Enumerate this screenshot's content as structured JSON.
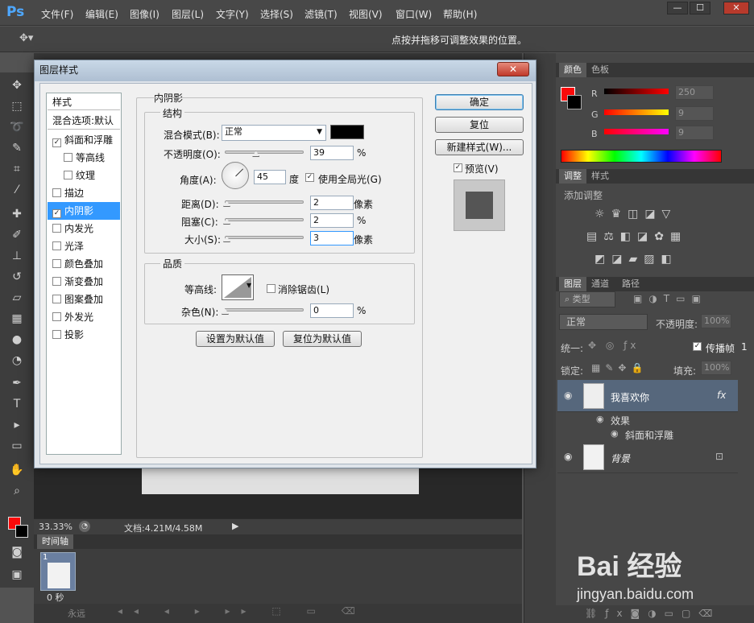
{
  "app": {
    "logo": "Ps"
  },
  "menu": [
    "文件(F)",
    "编辑(E)",
    "图像(I)",
    "图层(L)",
    "文字(Y)",
    "选择(S)",
    "滤镜(T)",
    "视图(V)",
    "窗口(W)",
    "帮助(H)"
  ],
  "window_buttons": [
    "—",
    "☐",
    "✕"
  ],
  "options_bar": {
    "hint": "点按并拖移可调整效果的位置。"
  },
  "dialog": {
    "title": "图层样式",
    "close": "✕",
    "styles_header": "样式",
    "blend_options": "混合选项:默认",
    "styles": [
      {
        "label": "斜面和浮雕",
        "checked": true,
        "indent": false
      },
      {
        "label": "等高线",
        "checked": false,
        "indent": true
      },
      {
        "label": "纹理",
        "checked": false,
        "indent": true
      },
      {
        "label": "描边",
        "checked": false,
        "indent": false
      },
      {
        "label": "内阴影",
        "checked": true,
        "indent": false,
        "selected": true
      },
      {
        "label": "内发光",
        "checked": false,
        "indent": false
      },
      {
        "label": "光泽",
        "checked": false,
        "indent": false
      },
      {
        "label": "颜色叠加",
        "checked": false,
        "indent": false
      },
      {
        "label": "渐变叠加",
        "checked": false,
        "indent": false
      },
      {
        "label": "图案叠加",
        "checked": false,
        "indent": false
      },
      {
        "label": "外发光",
        "checked": false,
        "indent": false
      },
      {
        "label": "投影",
        "checked": false,
        "indent": false
      }
    ],
    "section_title": "内阴影",
    "structure": {
      "title": "结构",
      "blend_mode_label": "混合模式(B):",
      "blend_mode_value": "正常",
      "opacity_label": "不透明度(O):",
      "opacity_value": "39",
      "opacity_unit": "%",
      "opacity_level": 0.39,
      "angle_label": "角度(A):",
      "angle_value": "45",
      "angle_unit": "度",
      "global_light_label": "使用全局光(G)",
      "global_light_checked": true,
      "distance_label": "距离(D):",
      "distance_value": "2",
      "distance_unit": "像素",
      "choke_label": "阻塞(C):",
      "choke_value": "2",
      "choke_unit": "%",
      "size_label": "大小(S):",
      "size_value": "3",
      "size_unit": "像素"
    },
    "quality": {
      "title": "品质",
      "contour_label": "等高线:",
      "antialias_label": "消除锯齿(L)",
      "noise_label": "杂色(N):",
      "noise_value": "0",
      "noise_unit": "%"
    },
    "make_default": "设置为默认值",
    "reset_default": "复位为默认值",
    "ok": "确定",
    "reset": "复位",
    "new_style": "新建样式(W)...",
    "preview_label": "预览(V)",
    "preview_checked": true
  },
  "status": {
    "zoom": "33.33%",
    "doc": "文档:4.21M/4.58M"
  },
  "timeline": {
    "tab": "时间轴",
    "frame_no": "1",
    "frame_time": "0 秒",
    "loop": "永远"
  },
  "color_panel": {
    "tabs": [
      "颜色",
      "色板"
    ],
    "r_label": "R",
    "g_label": "G",
    "b_label": "B",
    "r_value": "250",
    "g_value": "9",
    "b_value": "9",
    "fg_color": "#fa0909"
  },
  "adjust_panel": {
    "tabs": [
      "调整",
      "样式"
    ],
    "add_label": "添加调整"
  },
  "layers_panel": {
    "tabs": [
      "图层",
      "通道",
      "路径"
    ],
    "filter": "类型",
    "blend": "正常",
    "opacity_label": "不透明度:",
    "opacity_value": "100%",
    "unify_label": "统一:",
    "propagate_label": "传播帧",
    "propagate_value": "1",
    "lock_label": "锁定:",
    "fill_label": "填充:",
    "fill_value": "100%",
    "layers": [
      {
        "name": "我喜欢你",
        "fx": "fx"
      },
      {
        "name": "背景"
      }
    ],
    "effects_label": "效果",
    "effect_item": "斜面和浮雕"
  },
  "watermark": {
    "text": "Bai 经验",
    "url": "jingyan.baidu.com"
  }
}
